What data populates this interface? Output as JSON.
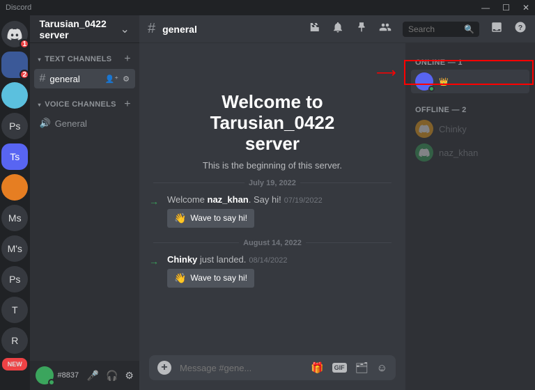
{
  "app_name": "Discord",
  "server": {
    "name": "Tarusian_0422 server",
    "text_channels_label": "TEXT CHANNELS",
    "voice_channels_label": "VOICE CHANNELS",
    "text_channels": [
      {
        "name": "general",
        "active": true
      }
    ],
    "voice_channels": [
      {
        "name": "General"
      }
    ]
  },
  "guilds": [
    {
      "id": "home",
      "badge": "1"
    },
    {
      "id": "srv1",
      "badge": "2",
      "color": "blue",
      "label": ""
    },
    {
      "id": "srv2",
      "color": "cyan",
      "label": ""
    },
    {
      "id": "srv3",
      "label": "Ps"
    },
    {
      "id": "srv4",
      "color": "blue",
      "label": "Ts"
    },
    {
      "id": "srv5",
      "color": "orange",
      "label": ""
    },
    {
      "id": "srv6",
      "label": "Ms"
    },
    {
      "id": "srv7",
      "label": "M's"
    },
    {
      "id": "srv8",
      "label": "Ps"
    },
    {
      "id": "srv9",
      "label": "T"
    },
    {
      "id": "srv10",
      "label": "R"
    }
  ],
  "new_label": "NEW",
  "user": {
    "tag": "#8837"
  },
  "channel_header": {
    "name": "general",
    "search_placeholder": "Search"
  },
  "welcome": {
    "title_l1": "Welcome to",
    "title_l2": "Tarusian_0422",
    "title_l3": "server",
    "subtitle": "This is the beginning of this server."
  },
  "dividers": [
    "July 19, 2022",
    "August 14, 2022"
  ],
  "messages": [
    {
      "pre": "Welcome ",
      "name": "naz_khan",
      "post": ". Say hi!",
      "date": "07/19/2022",
      "wave": "Wave to say hi!"
    },
    {
      "pre": "",
      "name": "Chinky",
      "post": " just landed.",
      "date": "08/14/2022",
      "wave": "Wave to say hi!"
    }
  ],
  "composer_placeholder": "Message #gene...",
  "members": {
    "online_label": "ONLINE — 1",
    "offline_label": "OFFLINE — 2",
    "online": [
      {
        "name": "",
        "owner": true
      }
    ],
    "offline": [
      {
        "name": "Chinky"
      },
      {
        "name": "naz_khan"
      }
    ]
  }
}
